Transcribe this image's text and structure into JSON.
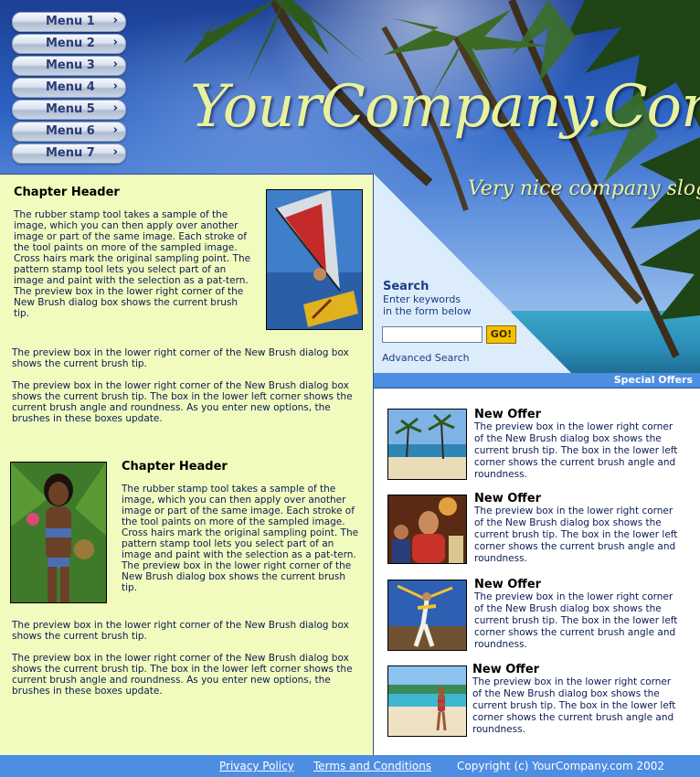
{
  "menu": [
    "Menu 1",
    "Menu 2",
    "Menu 3",
    "Menu 4",
    "Menu 5",
    "Menu 6",
    "Menu 7"
  ],
  "brand": {
    "logo": "YourCompany.Com",
    "slogan": "Very nice company slogan"
  },
  "chapters": [
    {
      "title": "Chapter Header",
      "intro": "The rubber stamp tool takes a sample of the image, which you can then apply over another image or part of the same image. Each stroke of the tool paints on more of the sampled image. Cross hairs mark the original sampling point. The pattern stamp tool lets you select part of an image and paint with the selection as a pat-tern. The preview box in the lower right corner of the New Brush dialog box shows the current brush tip.",
      "para1": "The preview box in the lower right corner of the New Brush dialog box shows the current brush tip.",
      "para2": "The preview box in the lower right corner of the New Brush dialog box shows the current brush tip. The box in the lower left corner shows the current brush angle and roundness. As you enter new options, the brushes in these boxes update."
    },
    {
      "title": "Chapter Header",
      "intro": "The rubber stamp tool takes a sample of the image, which you can then apply over another image or part of the same image. Each stroke of the tool paints on more of the sampled image. Cross hairs mark the original sampling point. The pattern stamp tool lets you select part of an image and paint with the selection as a pat-tern. The preview box in the lower right corner of the New Brush dialog box shows the current brush tip.",
      "para1": "The preview box in the lower right corner of the New Brush dialog box shows the current brush tip.",
      "para2": "The preview box in the lower right corner of the New Brush dialog box shows the current brush tip. The box in the lower left corner shows the current brush angle and roundness. As you enter new options, the brushes in these boxes update."
    }
  ],
  "search": {
    "title": "Search",
    "line1": "Enter keywords",
    "line2": "in the form below",
    "input_value": "",
    "go": "GO!",
    "advanced": "Advanced Search"
  },
  "offers": {
    "header": "Special Offers",
    "items": [
      {
        "title": "New Offer",
        "text": "The preview box in the lower right corner of the New Brush dialog box shows the current brush tip. The box in the lower left corner shows the current brush angle and roundness."
      },
      {
        "title": "New Offer",
        "text": "The preview box in the lower right corner of the New Brush dialog box shows the current brush tip. The box in the lower left corner shows the current brush angle and roundness."
      },
      {
        "title": "New Offer",
        "text": "The preview box in the lower right corner of the New Brush dialog box shows the current brush tip. The box in the lower left corner shows the current brush angle and roundness."
      },
      {
        "title": "New Offer",
        "text": "The preview box in the lower right corner of the New Brush dialog box shows the current brush tip. The box in the lower left corner shows the current brush angle and roundness."
      }
    ]
  },
  "footer": {
    "privacy": "Privacy Policy",
    "terms": "Terms and Conditions",
    "copyright": "Copyright (c) YourCompany.com  2002"
  },
  "colors": {
    "panel_yellow": "#f0fbbd",
    "accent_blue": "#4d8ee2",
    "logo_yellow": "#e9f29a",
    "go_button": "#f4c000"
  }
}
